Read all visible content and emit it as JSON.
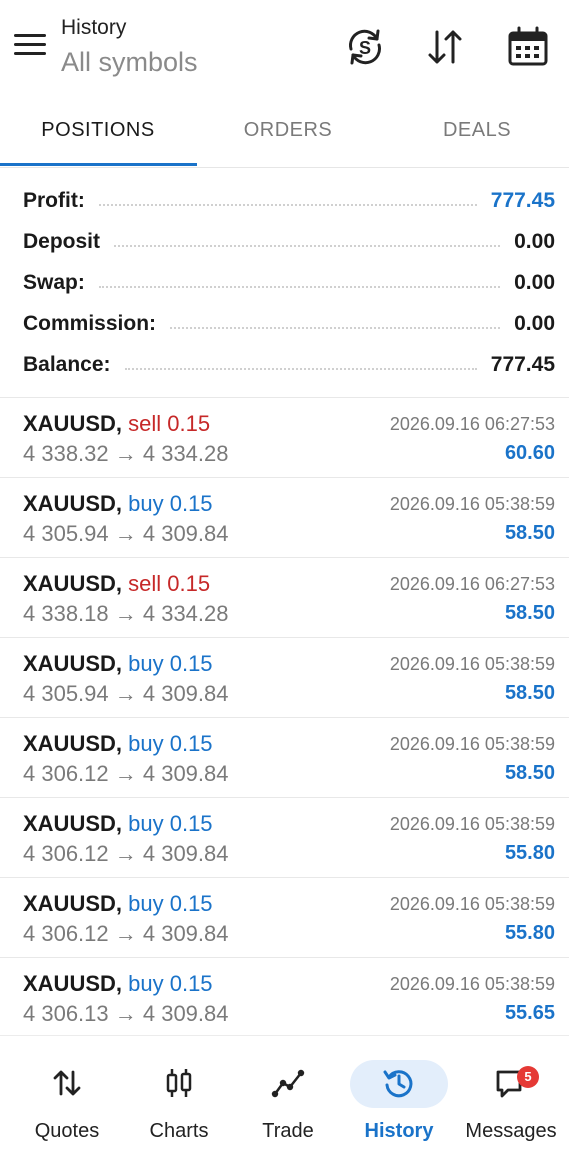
{
  "header": {
    "title_small": "History",
    "title_big": "All symbols",
    "icons": [
      "sync-currency-icon",
      "sort-icon",
      "calendar-icon"
    ]
  },
  "tabs": [
    {
      "label": "POSITIONS",
      "active": true
    },
    {
      "label": "ORDERS",
      "active": false
    },
    {
      "label": "DEALS",
      "active": false
    }
  ],
  "summary": [
    {
      "label": "Profit:",
      "value": "777.45",
      "highlight": true
    },
    {
      "label": "Deposit",
      "value": "0.00",
      "highlight": false
    },
    {
      "label": "Swap:",
      "value": "0.00",
      "highlight": false
    },
    {
      "label": "Commission:",
      "value": "0.00",
      "highlight": false
    },
    {
      "label": "Balance:",
      "value": "777.45",
      "highlight": false
    }
  ],
  "deals": [
    {
      "symbol": "XAUUSD,",
      "side": "sell 0.15",
      "type": "sell",
      "prices": "4 338.32 → 4 334.28",
      "time": "2026.09.16 06:27:53",
      "profit": "60.60"
    },
    {
      "symbol": "XAUUSD,",
      "side": "buy 0.15",
      "type": "buy",
      "prices": "4 305.94 → 4 309.84",
      "time": "2026.09.16 05:38:59",
      "profit": "58.50"
    },
    {
      "symbol": "XAUUSD,",
      "side": "sell 0.15",
      "type": "sell",
      "prices": "4 338.18 → 4 334.28",
      "time": "2026.09.16 06:27:53",
      "profit": "58.50"
    },
    {
      "symbol": "XAUUSD,",
      "side": "buy 0.15",
      "type": "buy",
      "prices": "4 305.94 → 4 309.84",
      "time": "2026.09.16 05:38:59",
      "profit": "58.50"
    },
    {
      "symbol": "XAUUSD,",
      "side": "buy 0.15",
      "type": "buy",
      "prices": "4 306.12 → 4 309.84",
      "time": "2026.09.16 05:38:59",
      "profit": "58.50"
    },
    {
      "symbol": "XAUUSD,",
      "side": "buy 0.15",
      "type": "buy",
      "prices": "4 306.12 → 4 309.84",
      "time": "2026.09.16 05:38:59",
      "profit": "55.80"
    },
    {
      "symbol": "XAUUSD,",
      "side": "buy 0.15",
      "type": "buy",
      "prices": "4 306.12 → 4 309.84",
      "time": "2026.09.16 05:38:59",
      "profit": "55.80"
    },
    {
      "symbol": "XAUUSD,",
      "side": "buy 0.15",
      "type": "buy",
      "prices": "4 306.13 → 4 309.84",
      "time": "2026.09.16 05:38:59",
      "profit": "55.65"
    }
  ],
  "bottom_nav": [
    {
      "label": "Quotes",
      "icon": "quotes-arrows-icon",
      "active": false
    },
    {
      "label": "Charts",
      "icon": "candlestick-icon",
      "active": false
    },
    {
      "label": "Trade",
      "icon": "trend-line-icon",
      "active": false
    },
    {
      "label": "History",
      "icon": "history-clock-icon",
      "active": true
    },
    {
      "label": "Messages",
      "icon": "message-icon",
      "active": false,
      "badge": "5"
    }
  ],
  "colors": {
    "accent": "#1a73c9",
    "sell": "#c62828",
    "muted": "#7a7a7a",
    "badge": "#e53935"
  }
}
